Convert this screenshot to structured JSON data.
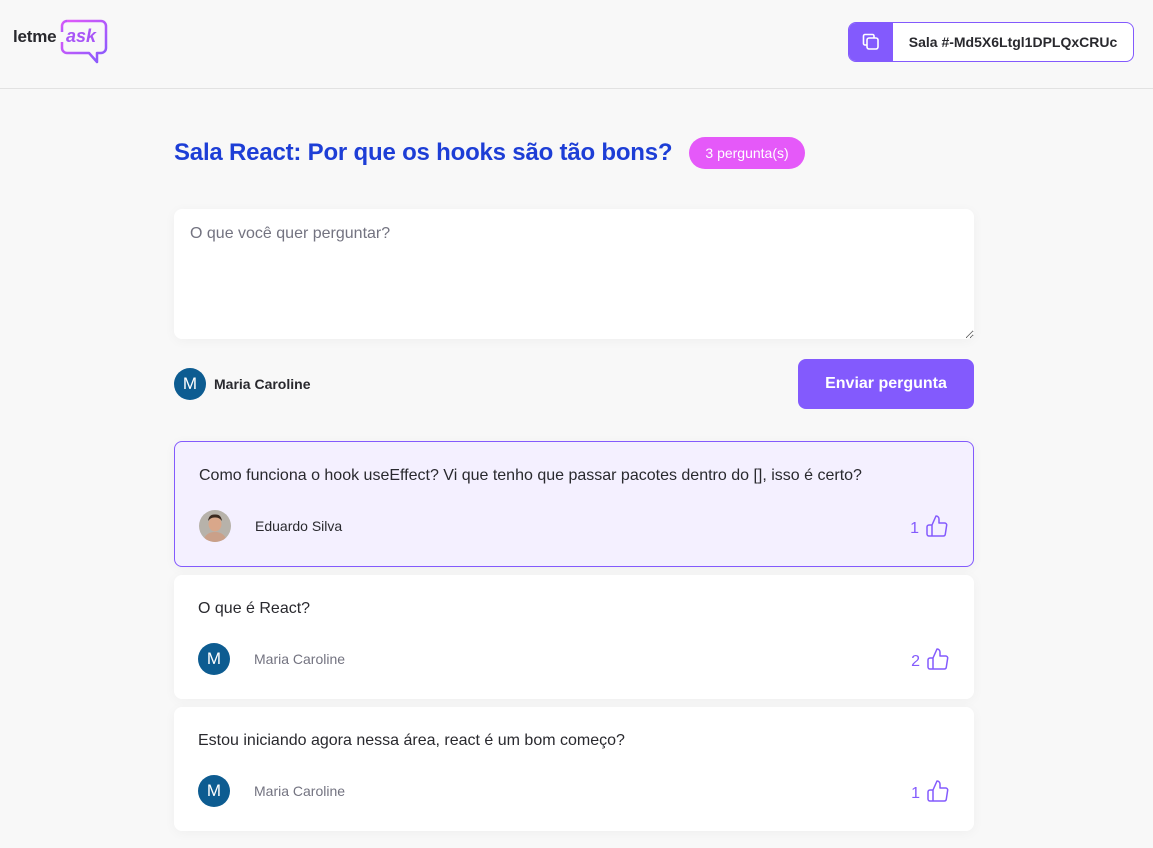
{
  "logo": {
    "letme": "letme",
    "ask": "ask"
  },
  "room_code": {
    "label": "Sala #-Md5X6Ltgl1DPLQxCRUc"
  },
  "room": {
    "title": "Sala React: Por que os hooks são tão bons?",
    "question_count": "3 pergunta(s)"
  },
  "form": {
    "placeholder": "O que você quer perguntar?",
    "user_initial": "M",
    "user_name": "Maria Caroline",
    "send_label": "Enviar pergunta"
  },
  "questions": [
    {
      "content": "Como funciona o hook useEffect? Vi que tenho que passar pacotes dentro do [], isso é certo?",
      "author": "Eduardo Silva",
      "likes": "1",
      "highlighted": true
    },
    {
      "content": "O que é React?",
      "author": "Maria Caroline",
      "author_initial": "M",
      "likes": "2"
    },
    {
      "content": "Estou iniciando agora nessa área, react é um bom começo?",
      "author": "Maria Caroline",
      "author_initial": "M",
      "likes": "1"
    }
  ],
  "colors": {
    "accent": "#835afd",
    "title": "#1d3ed6",
    "badge": "#e559f9",
    "avatar": "#0d5c91",
    "highlight_bg": "#f4f0ff"
  }
}
